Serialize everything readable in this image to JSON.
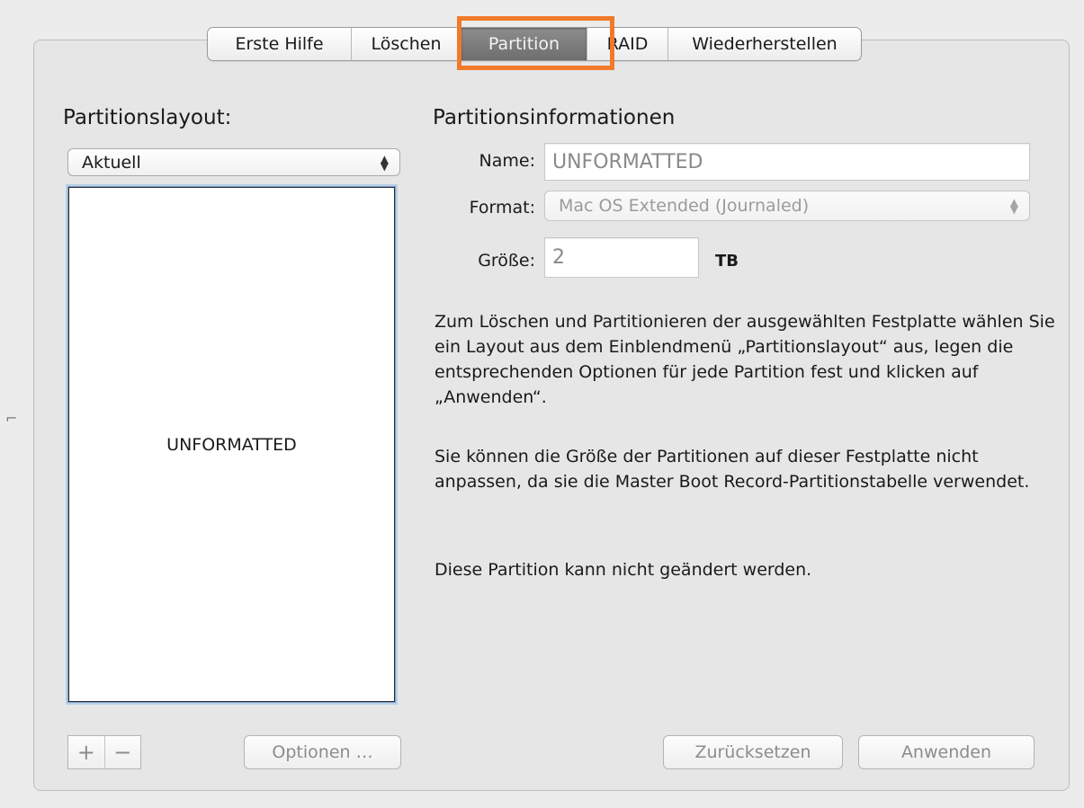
{
  "tabs": [
    {
      "label": "Erste Hilfe",
      "active": false
    },
    {
      "label": "Löschen",
      "active": false
    },
    {
      "label": "Partition",
      "active": true
    },
    {
      "label": "RAID",
      "active": false
    },
    {
      "label": "Wiederherstellen",
      "active": false
    }
  ],
  "highlight_color": "#f07a2a",
  "layout": {
    "heading": "Partitionslayout:",
    "select_value": "Aktuell",
    "partition_label": "UNFORMATTED",
    "add_label": "+",
    "remove_label": "−",
    "options_label": "Optionen …"
  },
  "info": {
    "heading": "Partitionsinformationen",
    "name_label": "Name:",
    "name_value": "UNFORMATTED",
    "format_label": "Format:",
    "format_value": "Mac OS Extended (Journaled)",
    "size_label": "Größe:",
    "size_value": "2",
    "size_unit": "TB",
    "paragraph1": "Zum Löschen und Partitionieren der ausgewählten Festplatte wählen Sie ein Layout aus dem Einblendmenü „Partitionslayout“ aus, legen die entsprechenden Optionen für jede Partition fest und klicken auf „Anwenden“.",
    "paragraph2": "Sie können die Größe der Partitionen auf dieser Festplatte nicht anpassen, da sie die Master Boot Record-Partitionstabelle verwendet.",
    "paragraph3": "Diese Partition kann nicht geändert werden."
  },
  "buttons": {
    "revert": "Zurücksetzen",
    "apply": "Anwenden"
  }
}
